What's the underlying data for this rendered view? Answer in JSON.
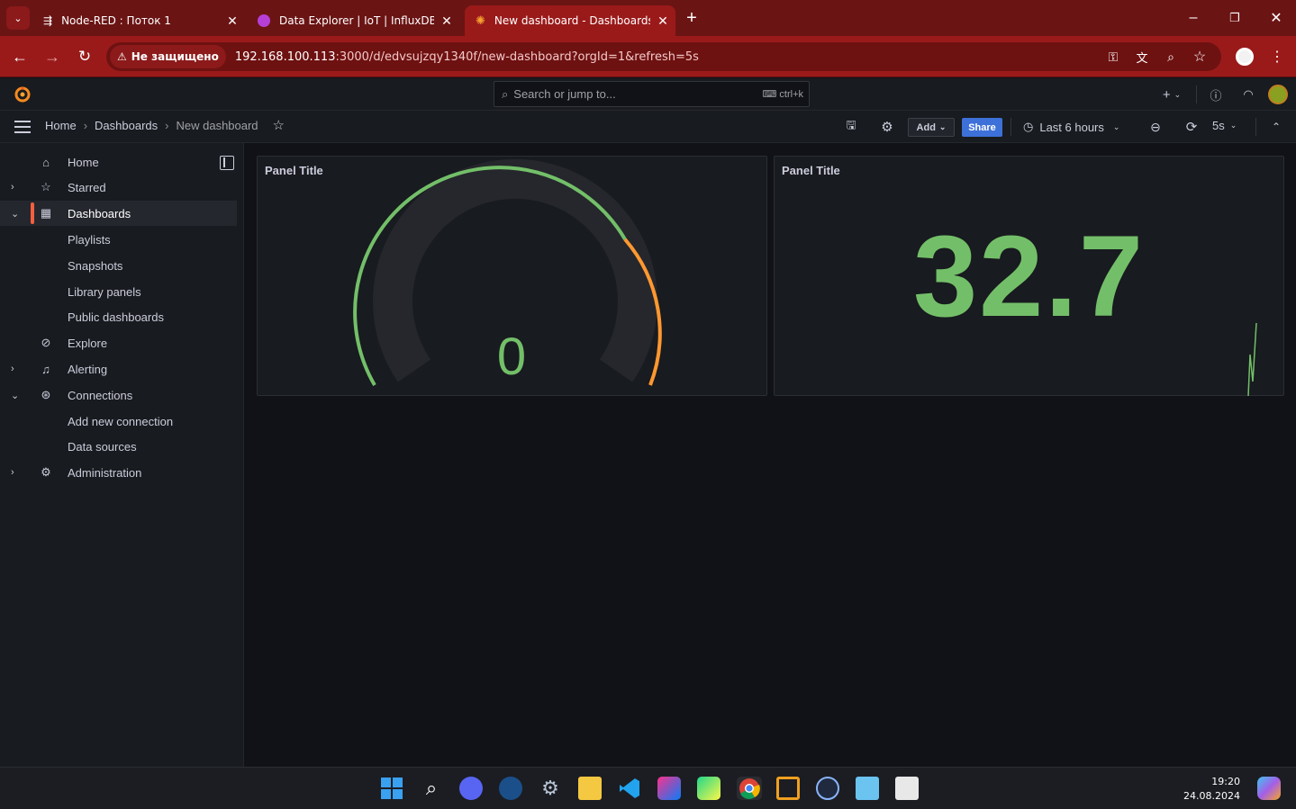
{
  "browser": {
    "tabs": [
      {
        "title": "Node-RED : Поток 1"
      },
      {
        "title": "Data Explorer | IoT | InfluxDB"
      },
      {
        "title": "New dashboard - Dashboards - G"
      }
    ],
    "security_label": "Не защищено",
    "url_host": "192.168.100.113",
    "url_rest": ":3000/d/edvsujzqy1340f/new-dashboard?orgId=1&refresh=5s"
  },
  "grafana": {
    "search_placeholder": "Search or jump to...",
    "search_shortcut": "ctrl+k",
    "breadcrumb": [
      "Home",
      "Dashboards",
      "New dashboard"
    ],
    "add_label": "Add",
    "share_label": "Share",
    "time_range": "Last 6 hours",
    "refresh_interval": "5s"
  },
  "sidebar": {
    "items": [
      {
        "label": "Home",
        "icon": "home-icon"
      },
      {
        "label": "Starred",
        "icon": "star-icon",
        "expandable": true
      },
      {
        "label": "Dashboards",
        "icon": "apps-icon",
        "expanded": true,
        "selected": true
      },
      {
        "label": "Playlists",
        "sub": true
      },
      {
        "label": "Snapshots",
        "sub": true
      },
      {
        "label": "Library panels",
        "sub": true
      },
      {
        "label": "Public dashboards",
        "sub": true
      },
      {
        "label": "Explore",
        "icon": "compass-icon"
      },
      {
        "label": "Alerting",
        "icon": "bell-icon",
        "expandable": true
      },
      {
        "label": "Connections",
        "icon": "connections-icon",
        "expanded": true
      },
      {
        "label": "Add new connection",
        "sub": true
      },
      {
        "label": "Data sources",
        "sub": true
      },
      {
        "label": "Administration",
        "icon": "cog-icon",
        "expandable": true
      }
    ]
  },
  "panels": [
    {
      "title": "Panel Title",
      "type": "gauge",
      "value": "0",
      "color": "#73bf69",
      "threshold_color": "#ff9830"
    },
    {
      "title": "Panel Title",
      "type": "stat",
      "value": "32.7",
      "color": "#73bf69"
    }
  ],
  "taskbar": {
    "time": "19:20",
    "date": "24.08.2024"
  }
}
